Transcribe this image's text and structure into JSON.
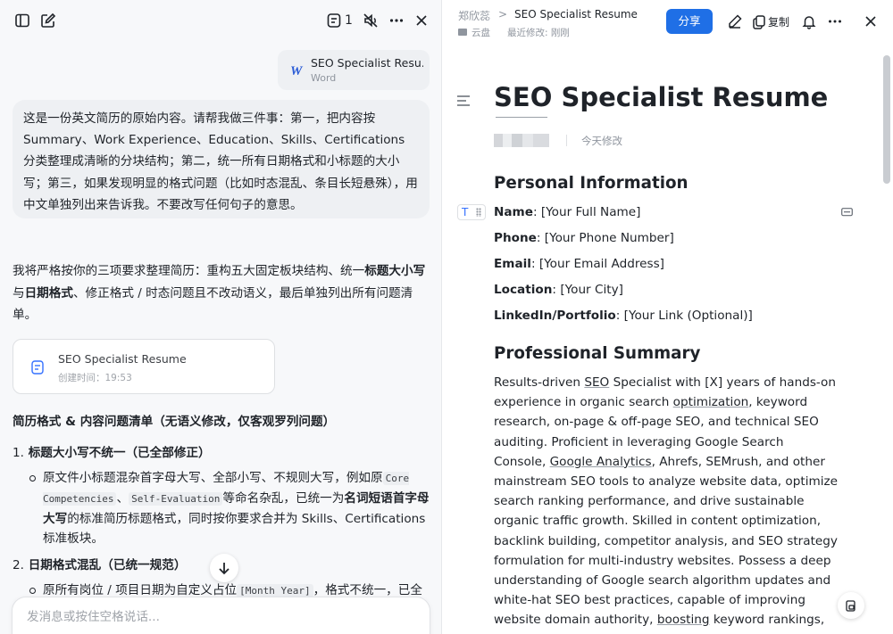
{
  "chat": {
    "toolbar": {
      "sidebar_icon": "sidebar-toggle-icon",
      "new_chat_icon": "edit-icon",
      "context_count": "1"
    },
    "attachment": {
      "name": "SEO Specialist Resu...",
      "type": "Word"
    },
    "user_message": "这是一份英文简历的原始内容。请帮我做三件事：第一，把内容按 Summary、Work Experience、Education、Skills、Certifications 分类整理成清晰的分块结构；第二，统一所有日期格式和小标题的大小写；第三，如果发现明显的格式问题（比如时态混乱、条目长短悬殊），用中文单独列出来告诉我。不要改写任何句子的意思。",
    "reply": {
      "intro_a": "我将严格按你的三项要求整理简历：重构五大固定板块结构、统一",
      "intro_b": "标题大小写",
      "intro_c": "与",
      "intro_d": "日期格式",
      "intro_e": "、修正格式 / 时态问题且不改动语义，最后单独列出所有问题清单。"
    },
    "doc_card": {
      "name": "SEO Specialist Resume",
      "created": "创建时间：19:53"
    },
    "section_title": "简历格式 & 内容问题清单（无语义修改，仅客观罗列问题）",
    "items": [
      {
        "num": "1.",
        "title": "标题大小写不统一（已全部修正）",
        "bullet": {
          "a": "原文件小标题混杂首字母大写、全部小写、不规则大写，例如原",
          "code1": "Core Competencies",
          "b": "、",
          "code2": "Self-Evaluation",
          "c": "等命名杂乱，已统一为",
          "bold": "名词短语首字母大写",
          "d": "的标准简历标题格式，同时按你要求合并为 Skills、Certifications 标准板块。"
        }
      },
      {
        "num": "2.",
        "title": "日期格式混乱（已统一规范）",
        "bullet": {
          "a": "原所有岗位 / 项目日期为自定义占位",
          "code1": "[Month Year]",
          "b": "，格式不统一，已全"
        }
      }
    ],
    "composer_placeholder": "发消息或按住空格说话..."
  },
  "document": {
    "breadcrumb": {
      "owner": "郑欣蕊",
      "separator": ">",
      "title": "SEO Specialist Resume",
      "location": "云盘",
      "last_modified": "最近修改: 刚刚"
    },
    "share_label": "分享",
    "copy_label": "复制",
    "title": "SEO Specialist Resume",
    "edited": "今天修改",
    "personal_heading": "Personal Information",
    "fields": [
      {
        "label": "Name",
        "value": ": [Your Full Name]"
      },
      {
        "label": "Phone",
        "value": ": [Your Phone Number]"
      },
      {
        "label": "Email",
        "value": ": [Your Email Address]"
      },
      {
        "label": "Location",
        "value": ": [Your City]"
      },
      {
        "label": "LinkedIn/Portfolio",
        "value": ": [Your Link (Optional)]"
      }
    ],
    "summary_heading": "Professional Summary",
    "summary": {
      "p1": "Results-driven ",
      "u1": "SEO",
      "p2": " Specialist with [X] years of hands-on experience in organic search ",
      "u2": "optimization",
      "p3": ", keyword research, on-page & off-page SEO, and technical SEO auditing. Proficient in leveraging Google Search Console, ",
      "u3": "Google Analytics",
      "p4": ", Ahrefs, SEMrush, and other mainstream SEO tools to analyze website data, optimize search ranking performance, and drive sustainable organic traffic growth. Skilled in content optimization, backlink building, competitor analysis, and SEO strategy formulation for multi-industry websites. Possess a deep understanding of Google search algorithm updates and white-hat SEO best practices, capable of improving website domain authority, ",
      "u4": "boosting",
      "p5": " keyword rankings, and increasing organic"
    },
    "block_type": "T"
  },
  "colors": {
    "accent": "#1f6fe6",
    "word_blue": "#2b5cd6",
    "doc_icon": "#3370ff"
  }
}
